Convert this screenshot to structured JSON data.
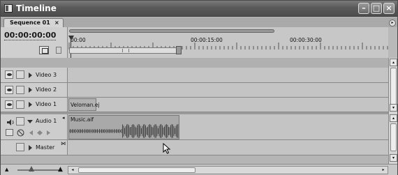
{
  "window": {
    "title": "Timeline",
    "controls": [
      "minimize",
      "maximize",
      "close"
    ]
  },
  "tabs": [
    {
      "label": "Sequence 01",
      "close_glyph": "×",
      "active": true
    }
  ],
  "header": {
    "timecode": "00:00:00:00"
  },
  "ruler": {
    "labels": [
      "00:00",
      "00:00:15:00",
      "00:00:30:00"
    ]
  },
  "video_tracks": [
    {
      "label": "Video 3"
    },
    {
      "label": "Video 2"
    },
    {
      "label": "Video 1"
    }
  ],
  "audio_tracks": [
    {
      "label": "Audio 1"
    },
    {
      "label": "Master"
    }
  ],
  "clips": {
    "video1_clip": "Veloman.ej",
    "audio1_clip": "Music.aif"
  },
  "colors": {
    "titlebar": "#5a5a5a",
    "panel": "#c4c4c4",
    "track_header": "#cdcdcd"
  }
}
